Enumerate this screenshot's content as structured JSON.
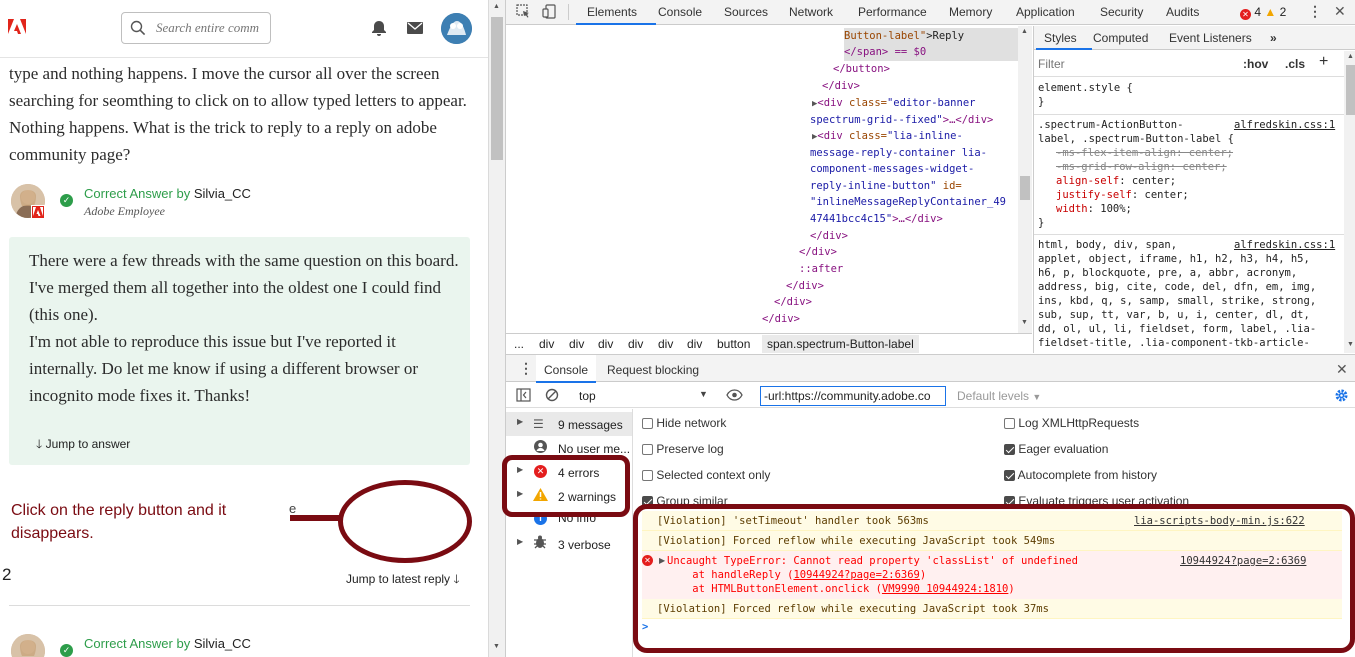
{
  "left": {
    "search_placeholder": "Search entire comm",
    "question_text": "type and nothing happens. I move the cursor all over the screen searching for seomthing to click on to allow typed letters to appear. Nothing happens. What is the trick to reply to a reply on adobe community page?",
    "answer1": {
      "label": "Correct Answer",
      "by": "by",
      "author": "Silvia_CC",
      "role": "Adobe Employee",
      "body_line1": "There were a few threads with the same question on this board. I've merged them all together into the oldest one I could find (this one).",
      "body_line2": "I'm not able to reproduce this issue but I've reported it internally. Do let me know if using a different browser or incognito mode fixes it. Thanks!",
      "jump": "Jump to answer"
    },
    "annotation": "Click on the reply button and it disappears.",
    "annotation_fragment": "e",
    "count": "2",
    "jump_latest": "Jump to latest reply",
    "answer2": {
      "label": "Correct Answer",
      "by": "by",
      "author": "Silvia_CC"
    }
  },
  "devtools": {
    "tabs": [
      "Elements",
      "Console",
      "Sources",
      "Network",
      "Performance",
      "Memory",
      "Application",
      "Security",
      "Audits"
    ],
    "error_count": "4",
    "warning_count": "2",
    "elements": {
      "l1_attrtail": "Button-label\"",
      "l1_text": ">Reply",
      "l2": "</span> == $0",
      "l3": "</button>",
      "l4": "</div>",
      "l5a": "<div ",
      "l5attr": "class=",
      "l5val": "\"editor-banner",
      "l6": "spectrum-grid--fixed\"",
      "l6b": ">…</div>",
      "l7a": "<div ",
      "l7attr": "class=",
      "l7val": "\"lia-inline-",
      "l8": "message-reply-container lia-",
      "l9": "component-messages-widget-",
      "l10a": "reply-inline-button\"",
      "l10attr": " id=",
      "l11": "\"inlineMessageReplyContainer_49",
      "l12a": "47441bcc4c15\"",
      "l12b": ">…</div>",
      "l13": "</div>",
      "l14": "</div>",
      "l15": "::after",
      "l16": "</div>",
      "l17": "</div>",
      "l18": "</div>"
    },
    "breadcrumb": [
      "...",
      "div",
      "div",
      "div",
      "div",
      "div",
      "div",
      "button",
      "span.spectrum-Button-label"
    ],
    "styles_tabs": [
      "Styles",
      "Computed",
      "Event Listeners",
      "»"
    ],
    "filter_placeholder": "Filter",
    "hov": ":hov",
    "cls": ".cls",
    "plus": "+",
    "styles": {
      "element_style": "element.style {",
      "close": "}",
      "rule1_sel1": ".spectrum-ActionButton-",
      "rule1_sel2": "label, .spectrum-Button-label {",
      "rule1_src": "alfredskin.css:1",
      "rule1_p1": "-ms-flex-item-align: center;",
      "rule1_p2": "-ms-grid-row-align: center;",
      "rule1_p3n": "align-self",
      "rule1_p3v": ": center;",
      "rule1_p4n": "justify-self",
      "rule1_p4v": ": center;",
      "rule1_p5n": "width",
      "rule1_p5v": ": 100%;",
      "rule2_src": "alfredskin.css:1",
      "rule2_lines": [
        "html, body, div, span,",
        "applet, object, iframe, h1, h2, h3, h4, h5,",
        "h6, p, blockquote, pre, a, abbr, acronym,",
        "address, big, cite, code, del, dfn, em, img,",
        "ins, kbd, q, s, samp, small, strike, strong,",
        "sub, sup, tt, var, b, u, i, center, dl, dt,",
        "dd, ol, ul, li, fieldset, form, label, .lia-",
        "fieldset-title, .lia-component-tkb-article-"
      ]
    },
    "drawer_tabs": [
      "Console",
      "Request blocking"
    ],
    "context": "top",
    "console_filter": "-url:https://community.adobe.co",
    "levels": "Default levels",
    "sidebar": [
      {
        "label": "9 messages"
      },
      {
        "label": "No user me..."
      },
      {
        "label": "4 errors"
      },
      {
        "label": "2 warnings"
      },
      {
        "label": "No info"
      },
      {
        "label": "3 verbose"
      }
    ],
    "options_left": [
      "Hide network",
      "Preserve log",
      "Selected context only",
      "Group similar"
    ],
    "options_right": [
      "Log XMLHttpRequests",
      "Eager evaluation",
      "Autocomplete from history",
      "Evaluate triggers user activation"
    ],
    "messages": {
      "m1": "[Violation] 'setTimeout' handler took 563ms",
      "m1_src": "lia-scripts-body-min.js:622",
      "m2": "[Violation] Forced reflow while executing JavaScript took 549ms",
      "e1": "Uncaught TypeError: Cannot read property 'classList' of undefined",
      "e1_src": "10944924?page=2:6369",
      "e1_l2a": "    at handleReply (",
      "e1_l2link": "10944924?page=2:6369",
      "e1_l2b": ")",
      "e1_l3a": "    at HTMLButtonElement.onclick (",
      "e1_l3link": "VM9990 10944924:1810",
      "e1_l3b": ")",
      "m3": "[Violation] Forced reflow while executing JavaScript took 37ms",
      "prompt": ">"
    }
  },
  "colors": {
    "annotation": "#7a0b12",
    "green": "#2d9d4a",
    "answer_bg": "#eaf5ee",
    "devtools_active": "#1a73e8"
  }
}
